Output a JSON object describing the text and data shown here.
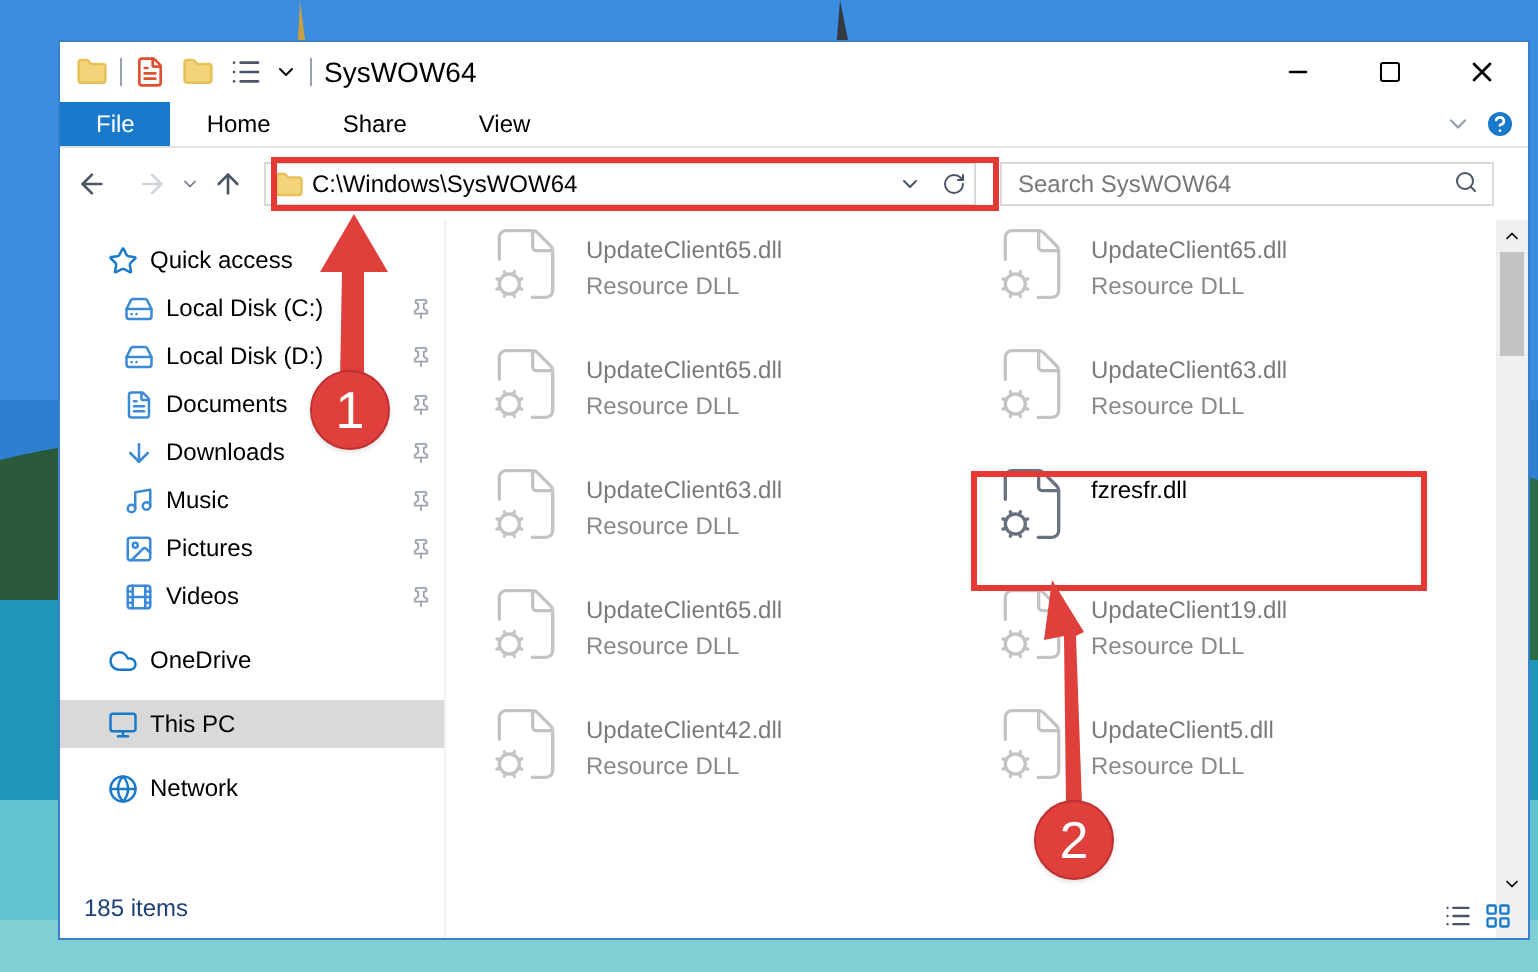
{
  "window": {
    "title": "SysWOW64"
  },
  "ribbon_tabs": [
    {
      "label": "File",
      "selected": true
    },
    {
      "label": "Home",
      "selected": false
    },
    {
      "label": "Share",
      "selected": false
    },
    {
      "label": "View",
      "selected": false
    }
  ],
  "address": {
    "value": "C:\\Windows\\SysWOW64"
  },
  "search": {
    "placeholder": "Search SysWOW64"
  },
  "sidebar": {
    "items": [
      {
        "label": "Quick access",
        "selected": false,
        "children": [
          {
            "label": "Local Disk (C:)",
            "selected": false
          },
          {
            "label": "Local Disk (D:)",
            "selected": false
          },
          {
            "label": "Documents",
            "selected": false
          },
          {
            "label": "Downloads",
            "selected": false
          },
          {
            "label": "Music",
            "selected": false
          },
          {
            "label": "Pictures",
            "selected": false
          },
          {
            "label": "Videos",
            "selected": false
          }
        ]
      },
      {
        "label": "OneDrive",
        "selected": false
      },
      {
        "label": "This PC",
        "selected": true
      },
      {
        "label": "Network",
        "selected": false
      }
    ]
  },
  "files": [
    {
      "name": "UpdateClient65.dll",
      "type": "Resource DLL",
      "kind": "blurred"
    },
    {
      "name": "UpdateClient65.dll",
      "type": "Resource DLL",
      "kind": "blurred"
    },
    {
      "name": "UpdateClient65.dll",
      "type": "Resource DLL",
      "kind": "blurred"
    },
    {
      "name": "UpdateClient63.dll",
      "type": "Resource DLL",
      "kind": "blurred"
    },
    {
      "name": "UpdateClient63.dll",
      "type": "Resource DLL",
      "kind": "blurred"
    },
    {
      "name": "fzresfr.dll",
      "kind": "focus"
    },
    {
      "name": "UpdateClient65.dll",
      "type": "Resource DLL",
      "kind": "blurred"
    },
    {
      "name": "UpdateClient19.dll",
      "type": "Resource DLL",
      "kind": "blurred"
    },
    {
      "name": "UpdateClient42.dll",
      "type": "Resource DLL",
      "kind": "blurred"
    },
    {
      "name": "UpdateClient5.dll",
      "type": "Resource DLL",
      "kind": "blurred"
    }
  ],
  "status_bar": {
    "count": "185 items"
  },
  "callouts": [
    "1",
    "2"
  ]
}
